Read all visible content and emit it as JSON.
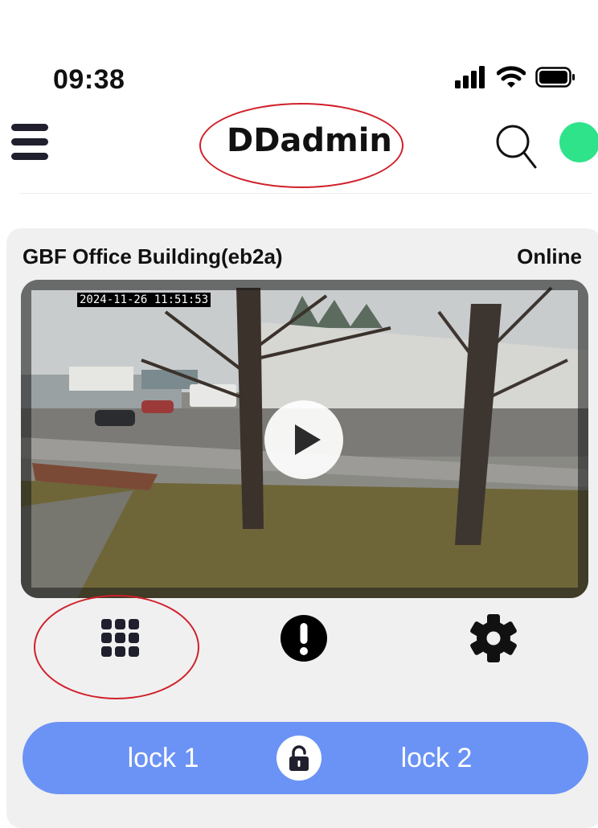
{
  "status_bar": {
    "time": "09:38"
  },
  "header": {
    "title": "DDadmin"
  },
  "device": {
    "name": "GBF Office Building(eb2a)",
    "status": "Online",
    "video": {
      "timestamp": "2024-11-26 11:51:53"
    }
  },
  "actions": {
    "keypad": "keypad-icon",
    "alert": "alert-icon",
    "settings": "gear-icon"
  },
  "locks": {
    "lock1_label": "lock 1",
    "lock2_label": "lock 2"
  },
  "colors": {
    "accent": "#6b93f5",
    "online": "#2fe38a",
    "annotation": "#d0202a"
  }
}
